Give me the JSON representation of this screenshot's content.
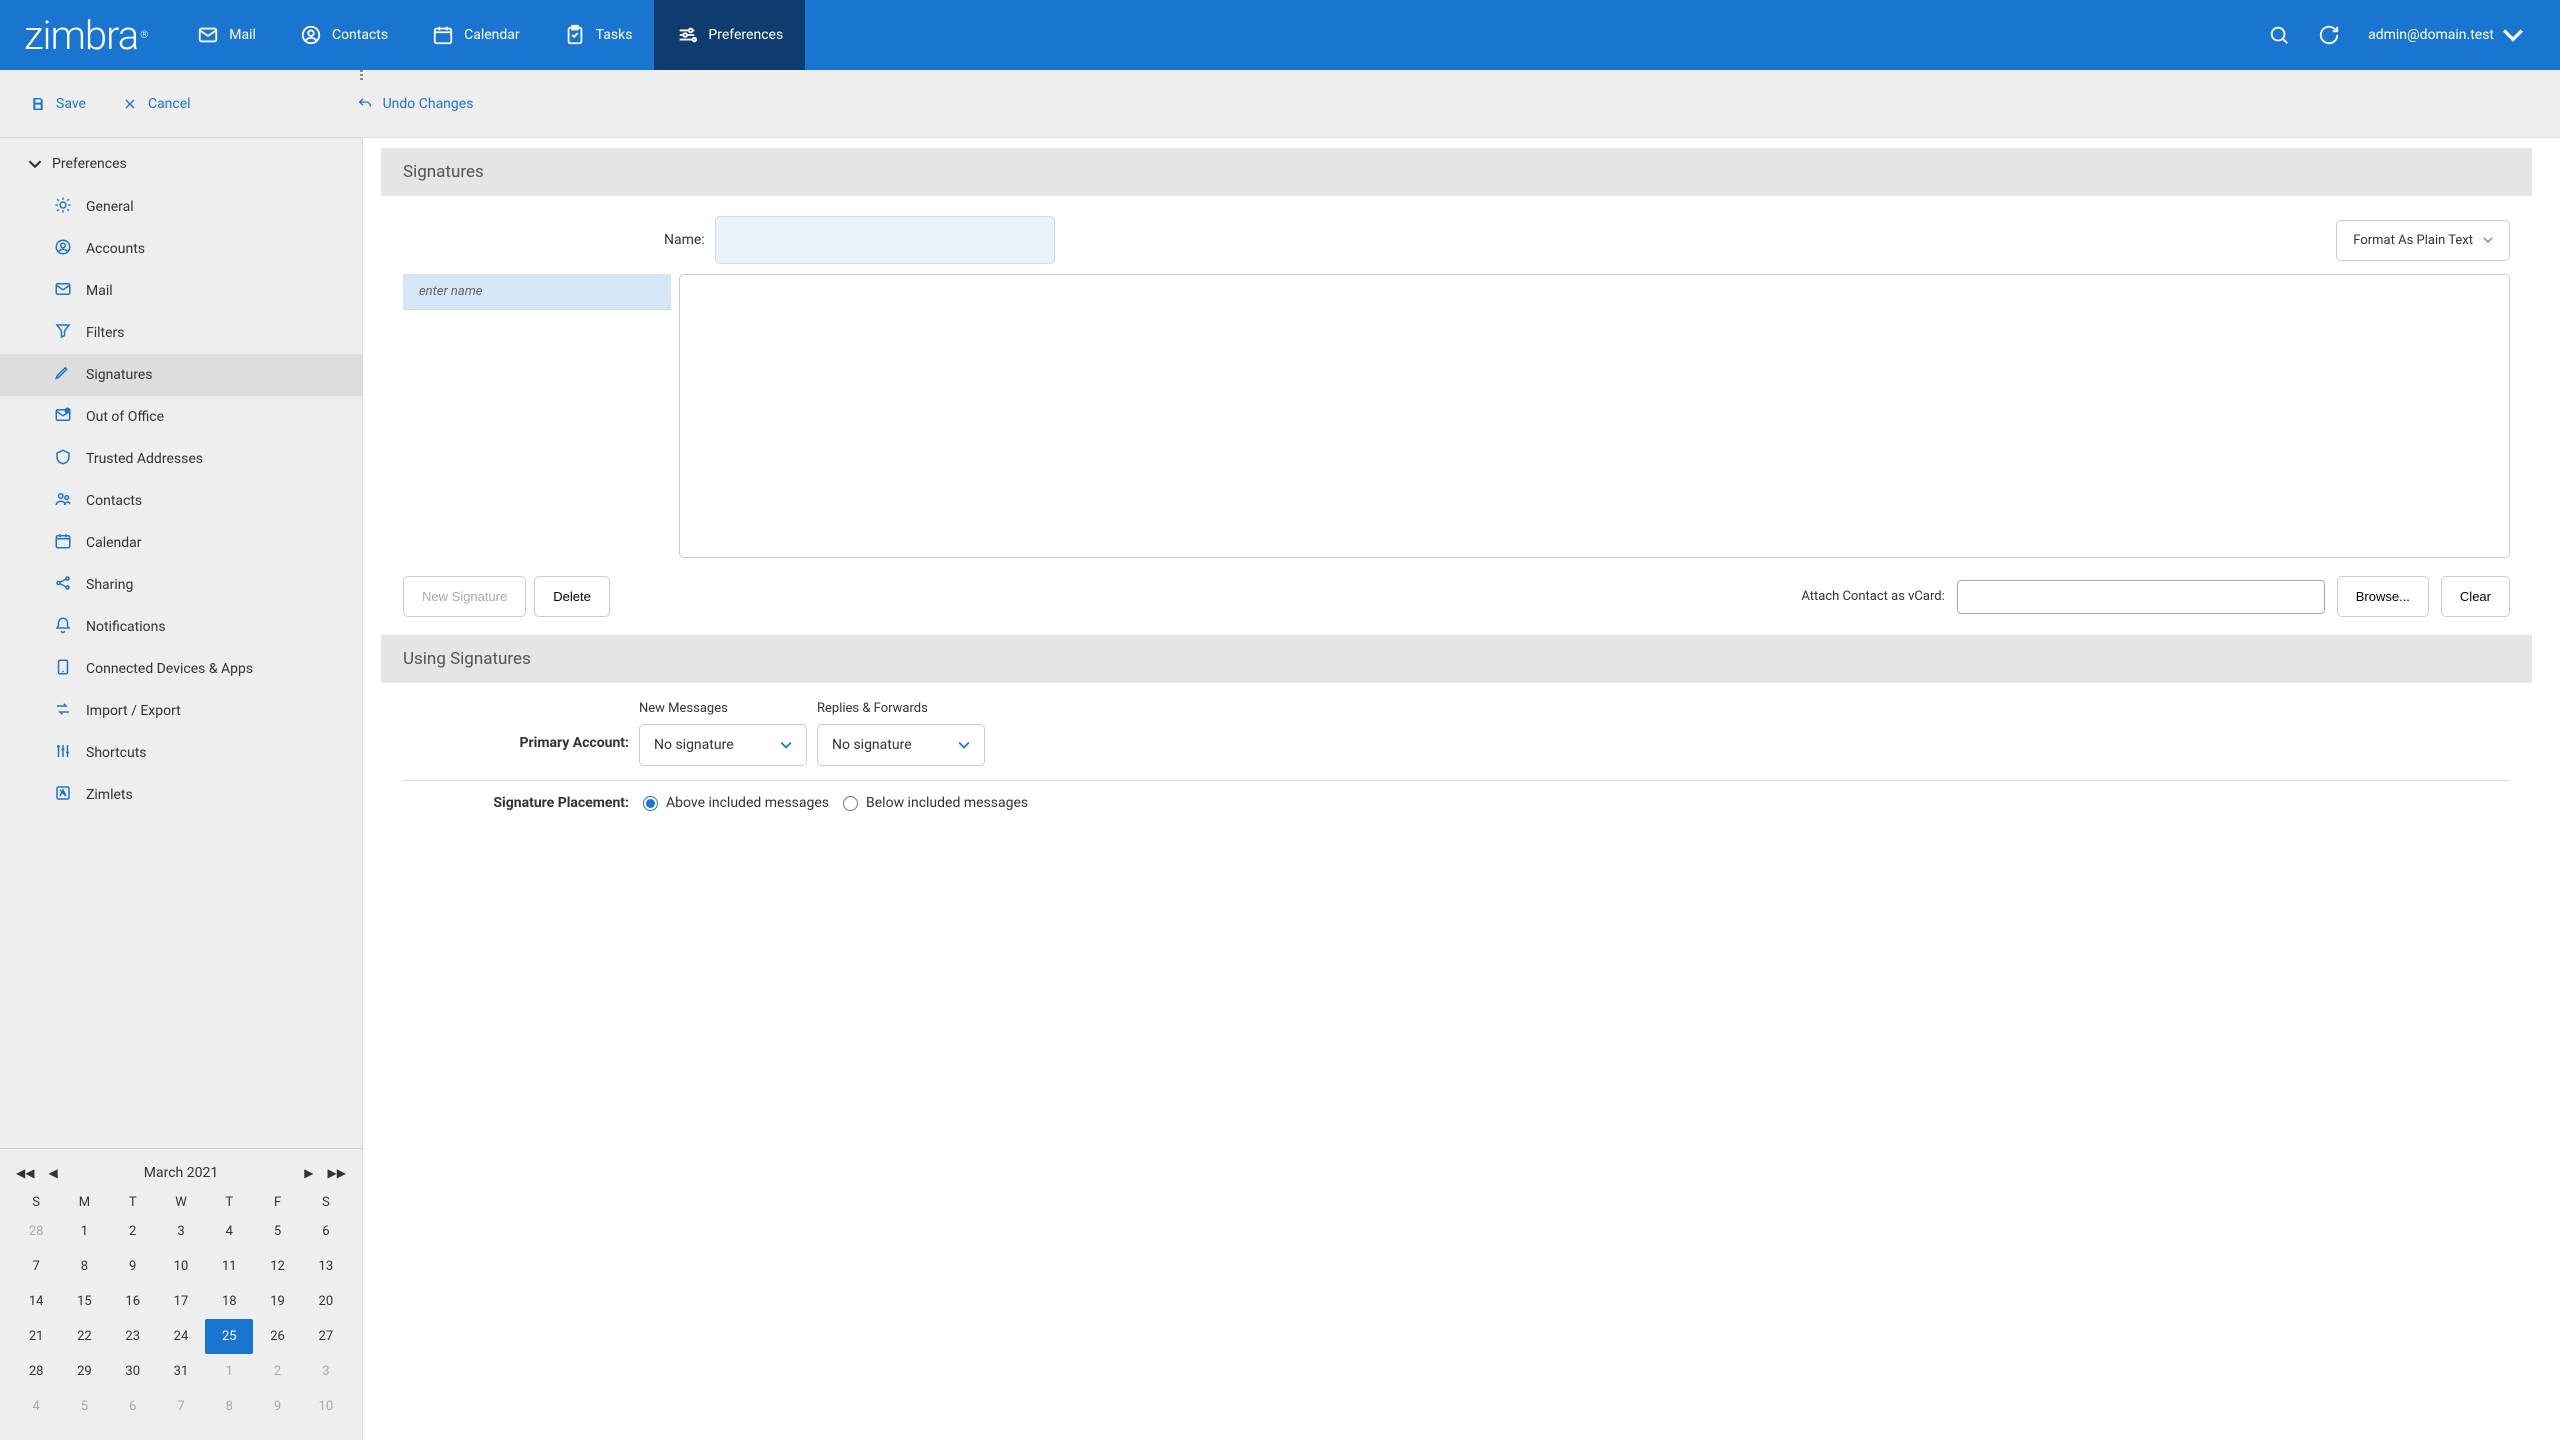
{
  "brand": "zimbra",
  "nav": {
    "mail": "Mail",
    "contacts": "Contacts",
    "calendar": "Calendar",
    "tasks": "Tasks",
    "preferences": "Preferences"
  },
  "user": "admin@domain.test",
  "actions": {
    "save": "Save",
    "cancel": "Cancel",
    "undo": "Undo Changes"
  },
  "sidebar": {
    "header": "Preferences",
    "items": [
      "General",
      "Accounts",
      "Mail",
      "Filters",
      "Signatures",
      "Out of Office",
      "Trusted Addresses",
      "Contacts",
      "Calendar",
      "Sharing",
      "Notifications",
      "Connected Devices & Apps",
      "Import / Export",
      "Shortcuts",
      "Zimlets"
    ],
    "activeIndex": 4
  },
  "signatures": {
    "heading": "Signatures",
    "name_label": "Name:",
    "format_dd": "Format As Plain Text",
    "list_placeholder": "enter name",
    "new_btn": "New Signature",
    "delete_btn": "Delete",
    "vcard_label": "Attach Contact as vCard:",
    "browse_btn": "Browse...",
    "clear_btn": "Clear"
  },
  "using": {
    "heading": "Using Signatures",
    "primary_label": "Primary Account:",
    "col_new": "New Messages",
    "col_reply": "Replies & Forwards",
    "no_sig": "No signature",
    "placement_label": "Signature Placement:",
    "opt_above": "Above included messages",
    "opt_below": "Below included messages"
  },
  "calendar": {
    "title": "March 2021",
    "dow": [
      "S",
      "M",
      "T",
      "W",
      "T",
      "F",
      "S"
    ],
    "grid": [
      {
        "d": 28,
        "m": true
      },
      {
        "d": 1
      },
      {
        "d": 2
      },
      {
        "d": 3
      },
      {
        "d": 4
      },
      {
        "d": 5
      },
      {
        "d": 6
      },
      {
        "d": 7
      },
      {
        "d": 8
      },
      {
        "d": 9
      },
      {
        "d": 10
      },
      {
        "d": 11
      },
      {
        "d": 12
      },
      {
        "d": 13
      },
      {
        "d": 14
      },
      {
        "d": 15
      },
      {
        "d": 16
      },
      {
        "d": 17
      },
      {
        "d": 18
      },
      {
        "d": 19
      },
      {
        "d": 20
      },
      {
        "d": 21
      },
      {
        "d": 22
      },
      {
        "d": 23
      },
      {
        "d": 24
      },
      {
        "d": 25,
        "t": true
      },
      {
        "d": 26
      },
      {
        "d": 27
      },
      {
        "d": 28
      },
      {
        "d": 29
      },
      {
        "d": 30
      },
      {
        "d": 31
      },
      {
        "d": 1,
        "m": true
      },
      {
        "d": 2,
        "m": true
      },
      {
        "d": 3,
        "m": true
      },
      {
        "d": 4,
        "m": true
      },
      {
        "d": 5,
        "m": true
      },
      {
        "d": 6,
        "m": true
      },
      {
        "d": 7,
        "m": true
      },
      {
        "d": 8,
        "m": true
      },
      {
        "d": 9,
        "m": true
      },
      {
        "d": 10,
        "m": true
      }
    ]
  }
}
